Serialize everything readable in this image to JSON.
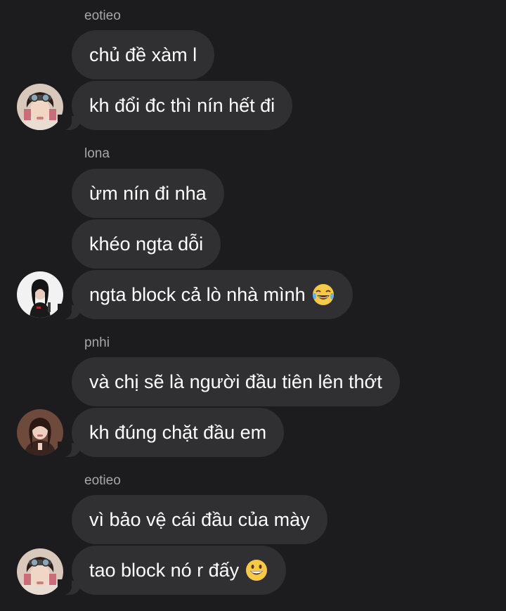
{
  "messages": [
    {
      "sender": "eotieo",
      "texts": [
        "chủ đề xàm l",
        "kh đổi đc thì nín hết đi"
      ]
    },
    {
      "sender": "lona",
      "texts": [
        "ừm nín đi nha",
        "khéo ngta dỗi",
        "ngta block cả lò nhà mình"
      ],
      "last_emoji": "tears-of-joy-emoji"
    },
    {
      "sender": "pnhi",
      "texts": [
        "và chị sẽ là người đầu tiên lên thớt",
        "kh đúng chặt đầu em"
      ]
    },
    {
      "sender": "eotieo",
      "texts": [
        "vì bảo vệ cái đầu của mày",
        "tao block nó r đấy"
      ],
      "last_emoji": "grinning-emoji"
    }
  ],
  "colors": {
    "background": "#1c1c1e",
    "bubble": "#303033",
    "sender_name": "#a6a6ab",
    "text": "#ffffff"
  }
}
